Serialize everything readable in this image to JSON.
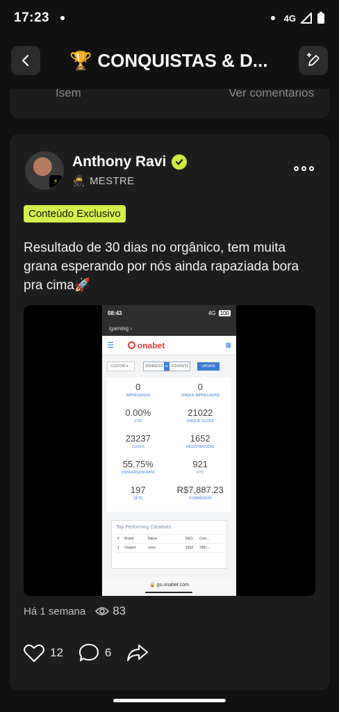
{
  "status": {
    "time": "17:23",
    "network": "4G"
  },
  "header": {
    "title": "CONQUISTAS & D...",
    "trophy": "🏆"
  },
  "prev_card": {
    "left_text": "Isem",
    "right_text": "Ver comentários"
  },
  "post": {
    "author": "Anthony Ravi",
    "role": "MESTRE",
    "role_emoji": "🥷",
    "tag": "Conteúdo Exclusivo",
    "text": "Resultado de 30 dias no orgânico, tem muita grana esperando por nós ainda rapaziada bora pra cima🚀",
    "time_ago": "Há 1 semana",
    "views": "83",
    "likes": "12",
    "comments": "6"
  },
  "screenshot": {
    "time": "08:43",
    "net": "4G",
    "battery": "100",
    "crumb": "igaming ›",
    "brand": "onabet",
    "filter_label": "CUSTOM",
    "date_from": "2024/02/12",
    "date_to_label": "to",
    "date_to": "2024/03/12",
    "update_label": "UPDATE",
    "stats": [
      {
        "value": "0",
        "label": "IMPRESSIONS"
      },
      {
        "value": "0",
        "label": "UNIQUE IMPRESSIONS"
      },
      {
        "value": "0.00%",
        "label": "CTR"
      },
      {
        "value": "21022",
        "label": "UNIQUE CLICKS"
      },
      {
        "value": "23237",
        "label": "CLICKS"
      },
      {
        "value": "1652",
        "label": "REGISTRATIONS"
      },
      {
        "value": "55.75%",
        "label": "CONVERSION RATE"
      },
      {
        "value": "921",
        "label": "FTD"
      },
      {
        "value": "197",
        "label": "QFTD"
      },
      {
        "value": "R$7,887.23",
        "label": "COMMISSION"
      }
    ],
    "table_title": "Top Performing Creatives",
    "table_header": [
      "#",
      "Brand",
      "Name",
      "REG",
      "Com..."
    ],
    "table_row": [
      "1",
      "Onabet",
      "none",
      "1652",
      "7887..."
    ],
    "url": "go.onabet.com"
  }
}
